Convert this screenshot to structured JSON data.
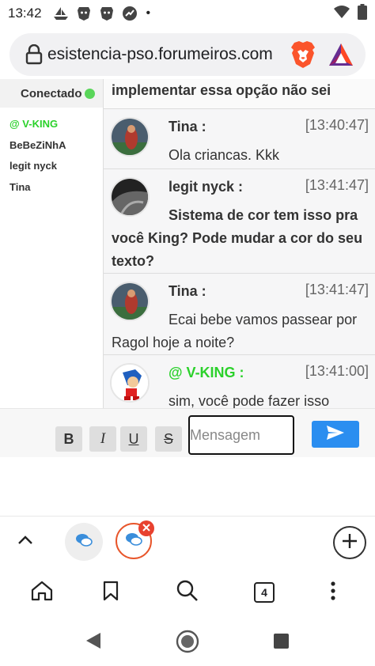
{
  "status_bar": {
    "time": "13:42",
    "dot": "•",
    "icons": [
      "boat-icon",
      "brave-shield-icon",
      "brave-shield-icon",
      "rocket-chat-icon",
      "wifi-icon",
      "battery-icon"
    ]
  },
  "browser": {
    "url": "esistencia-pso.forumeiros.com",
    "tab_count": "4"
  },
  "sidebar": {
    "header": "Conectado",
    "users": [
      {
        "name": "@ V-KING",
        "admin": true
      },
      {
        "name": "BeBeZiNhA",
        "admin": false
      },
      {
        "name": "legit nyck",
        "admin": false
      },
      {
        "name": "Tina",
        "admin": false
      }
    ]
  },
  "chat": {
    "top_fragment": "implementar essa opção não sei",
    "messages": [
      {
        "author": "Tina :",
        "time": "[13:40:47]",
        "text": "Ola criancas. Kkk",
        "bold": false,
        "admin": false
      },
      {
        "author": "legit nyck :",
        "time": "[13:41:47]",
        "text": "Sistema de cor tem isso pra você King? Pode mudar a cor do seu texto?",
        "bold": true,
        "admin": false
      },
      {
        "author": "Tina :",
        "time": "[13:41:47]",
        "text": "Ecai bebe vamos passear por Ragol hoje a noite?",
        "bold": false,
        "admin": false
      },
      {
        "author": "@ V-KING :",
        "time": "[13:41:00]",
        "text": "sim, você pode fazer isso",
        "bold": false,
        "admin": true
      }
    ]
  },
  "composer": {
    "bold_label": "B",
    "italic_label": "I",
    "underline_label": "U",
    "strike_label": "S",
    "placeholder": "Mensagem"
  },
  "colors": {
    "admin_green": "#2bd12b",
    "online_dot": "#5ad65a",
    "send_blue": "#2b8ef0",
    "brave_orange": "#fb542b",
    "active_tab_ring": "#e8562b"
  }
}
